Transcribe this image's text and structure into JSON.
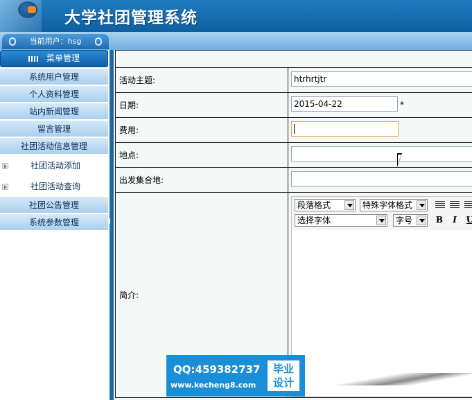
{
  "header": {
    "title": "大学社团管理系统"
  },
  "user_bar": {
    "label": "当前用户：hsg"
  },
  "sidebar": {
    "menu_title": "菜单管理",
    "items": [
      {
        "label": "系统用户管理"
      },
      {
        "label": "个人资料管理"
      },
      {
        "label": "站内新闻管理"
      },
      {
        "label": "留言管理"
      },
      {
        "label": "社团活动信息管理"
      },
      {
        "label": "社团活动添加"
      },
      {
        "label": "社团活动查询"
      },
      {
        "label": "社团公告管理"
      },
      {
        "label": "系统参数管理"
      }
    ]
  },
  "form": {
    "fields": [
      {
        "label": "活动主题:",
        "value": "htrhrtjtr"
      },
      {
        "label": "日期:",
        "value": "2015-04-22",
        "required_mark": "*"
      },
      {
        "label": "费用:",
        "value": ""
      },
      {
        "label": "地点:",
        "value": ""
      },
      {
        "label": "出发集合地:",
        "value": ""
      },
      {
        "label": "简介:"
      }
    ]
  },
  "editor": {
    "paragraph_format": "段落格式",
    "special_format": "特殊字体格式",
    "font_select": "选择字体",
    "font_size": "字号",
    "bold": "B",
    "italic": "I",
    "underline": "U"
  },
  "watermark": {
    "qq": "QQ:459382737",
    "url": "www.kecheng8.com",
    "badge_line1": "毕业",
    "badge_line2": "设计"
  }
}
